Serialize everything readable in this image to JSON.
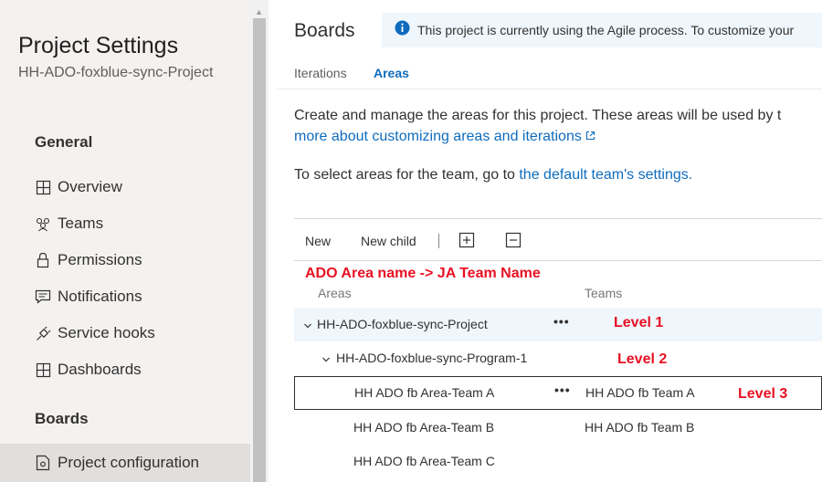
{
  "sidebar": {
    "title": "Project Settings",
    "project_name": "HH-ADO-foxblue-sync-Project",
    "sections": [
      {
        "heading": "General",
        "items": [
          {
            "label": "Overview",
            "icon": "overview-icon"
          },
          {
            "label": "Teams",
            "icon": "teams-icon"
          },
          {
            "label": "Permissions",
            "icon": "lock-icon"
          },
          {
            "label": "Notifications",
            "icon": "notifications-icon"
          },
          {
            "label": "Service hooks",
            "icon": "service-hooks-icon"
          },
          {
            "label": "Dashboards",
            "icon": "dashboards-icon"
          }
        ]
      },
      {
        "heading": "Boards",
        "items": [
          {
            "label": "Project configuration",
            "icon": "project-configuration-icon"
          }
        ]
      }
    ]
  },
  "header": {
    "title": "Boards",
    "info_text": "This project is currently using the Agile process. To customize your",
    "tabs": [
      {
        "label": "Iterations",
        "selected": false
      },
      {
        "label": "Areas",
        "selected": true
      }
    ]
  },
  "description": {
    "line1": "Create and manage the areas for this project. These areas will be used by t",
    "link": "more about customizing areas and iterations",
    "line2_prefix": "To select areas for the team, go to ",
    "line2_link": "the default team's settings."
  },
  "toolbar": {
    "new_label": "New",
    "new_child_label": "New child",
    "expand_icon": "expand-all-icon",
    "collapse_icon": "collapse-all-icon"
  },
  "annotations": {
    "header_note": "ADO Area name -> JA Team Name",
    "level1": "Level 1",
    "level2": "Level 2",
    "level3": "Level 3"
  },
  "table": {
    "columns": [
      "Areas",
      "Teams"
    ],
    "rows": [
      {
        "area": "HH-ADO-foxblue-sync-Project",
        "team": "",
        "level": 1,
        "expanded": true,
        "more": "•••"
      },
      {
        "area": "HH-ADO-foxblue-sync-Program-1",
        "team": "",
        "level": 2,
        "expanded": true,
        "more": ""
      },
      {
        "area": "HH ADO fb Area-Team A",
        "team": "HH ADO fb Team A",
        "level": 3,
        "selected": true,
        "more": "•••"
      },
      {
        "area": "HH ADO fb Area-Team B",
        "team": "HH ADO fb Team B",
        "level": 3,
        "more": ""
      },
      {
        "area": "HH ADO fb Area-Team C",
        "team": "",
        "level": 3,
        "more": ""
      }
    ]
  },
  "colors": {
    "accent": "#0f6cbd",
    "annotation": "#e81123",
    "info_bg": "#eff6fc",
    "sidebar_bg": "#f3f2f1"
  }
}
